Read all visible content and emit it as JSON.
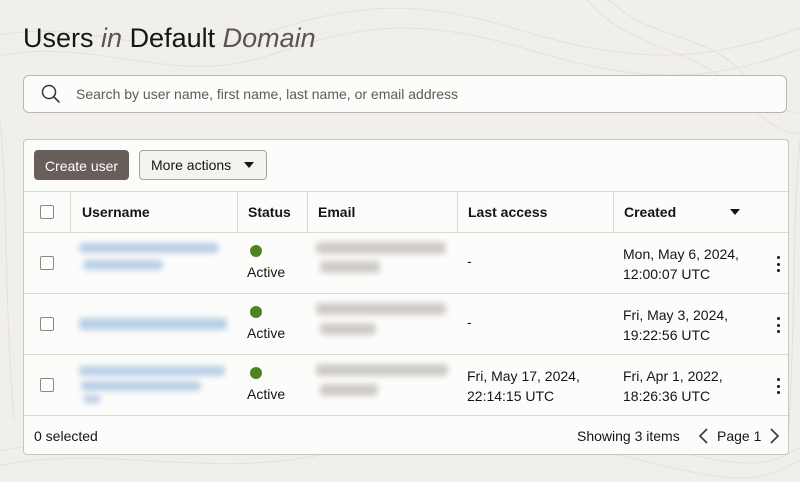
{
  "page": {
    "title_part1": "Users",
    "title_part2": "in",
    "title_part3": "Default",
    "title_part4": "Domain"
  },
  "search": {
    "placeholder": "Search by user name, first name, last name, or email address",
    "value": ""
  },
  "toolbar": {
    "create_label": "Create user",
    "more_actions_label": "More actions"
  },
  "table": {
    "columns": {
      "username": "Username",
      "status": "Status",
      "email": "Email",
      "last_access": "Last access",
      "created": "Created"
    },
    "rows": [
      {
        "status": "Active",
        "last_access": "-",
        "last_access_line2": "",
        "created_line1": "Mon, May 6, 2024,",
        "created_line2": "12:00:07 UTC"
      },
      {
        "status": "Active",
        "last_access": "-",
        "last_access_line2": "",
        "created_line1": "Fri, May 3, 2024,",
        "created_line2": "19:22:56 UTC"
      },
      {
        "status": "Active",
        "last_access": "Fri, May 17, 2024,",
        "last_access_line2": "22:14:15 UTC",
        "created_line1": "Fri, Apr 1, 2022,",
        "created_line2": "18:26:36 UTC"
      }
    ]
  },
  "footer": {
    "selected": "0 selected",
    "showing": "Showing 3 items",
    "page": "Page 1"
  },
  "colors": {
    "background": "#f1efec",
    "primary_button": "#685f5a",
    "status_active": "#508223",
    "redacted_username": "#b9cfe6",
    "redacted_email": "#cfcbc6"
  },
  "icons": {
    "search": "search-icon",
    "more_actions_caret": "caret-down-icon",
    "sort": "sort-descending-icon",
    "row_actions": "kebab-menu-icon",
    "prev": "chevron-left-icon",
    "next": "chevron-right-icon"
  }
}
